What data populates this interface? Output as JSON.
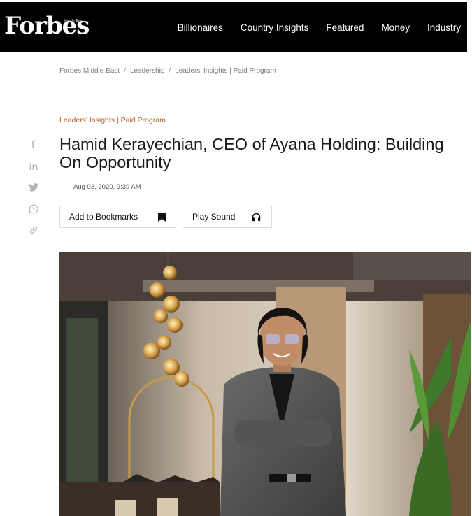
{
  "header": {
    "logo": "Forbes",
    "logo_sub": "Middle East",
    "nav": [
      "Billionaires",
      "Country Insights",
      "Featured",
      "Money",
      "Industry"
    ]
  },
  "breadcrumb": [
    "Forbes Middle East",
    "Leadership",
    "Leaders' Insights | Paid Program"
  ],
  "article": {
    "category": "Leaders' Insights | Paid Program",
    "title": "Hamid Kerayechian, CEO of Ayana Holding: Building On Opportunity",
    "date": "Aug 03, 2020, 9:39 AM",
    "bookmark_label": "Add to Bookmarks",
    "sound_label": "Play Sound"
  },
  "share": {
    "icons": [
      "facebook-icon",
      "linkedin-icon",
      "twitter-icon",
      "whatsapp-icon",
      "link-icon"
    ]
  },
  "colors": {
    "header_bg": "#000000",
    "accent": "#b5632b",
    "share_icon": "#b5b5b5"
  }
}
